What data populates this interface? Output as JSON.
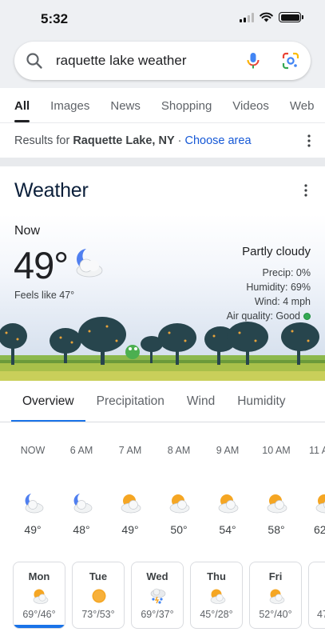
{
  "status_bar": {
    "time": "5:32"
  },
  "search": {
    "query": "raquette lake weather"
  },
  "tabs": [
    "All",
    "Images",
    "News",
    "Shopping",
    "Videos",
    "Web"
  ],
  "results_for": {
    "prefix": "Results for",
    "place": "Raquette Lake, NY",
    "separator": "·",
    "link": "Choose area"
  },
  "weather": {
    "title": "Weather",
    "now_label": "Now",
    "temp": "49°",
    "feels_like": "Feels like 47°",
    "condition": "Partly cloudy",
    "precip": "Precip: 0%",
    "humidity": "Humidity: 69%",
    "wind": "Wind: 4 mph",
    "air_quality": "Air quality: Good"
  },
  "weather_tabs": [
    "Overview",
    "Precipitation",
    "Wind",
    "Humidity"
  ],
  "hourly": [
    {
      "time": "NOW",
      "temp": "49°",
      "icon": "moon-cloud-icon"
    },
    {
      "time": "6 AM",
      "temp": "48°",
      "icon": "moon-cloud-icon"
    },
    {
      "time": "7 AM",
      "temp": "49°",
      "icon": "sun-cloud-icon"
    },
    {
      "time": "8 AM",
      "temp": "50°",
      "icon": "sun-cloud-icon"
    },
    {
      "time": "9 AM",
      "temp": "54°",
      "icon": "sun-cloud-icon"
    },
    {
      "time": "10 AM",
      "temp": "58°",
      "icon": "sun-cloud-icon"
    },
    {
      "time": "11 A",
      "temp": "62",
      "icon": "sun-cloud-icon"
    }
  ],
  "daily": [
    {
      "day": "Mon",
      "range": "69°/46°",
      "icon": "sun-cloud-icon"
    },
    {
      "day": "Tue",
      "range": "73°/53°",
      "icon": "sun-icon"
    },
    {
      "day": "Wed",
      "range": "69°/37°",
      "icon": "rain-thunder-icon"
    },
    {
      "day": "Thu",
      "range": "45°/28°",
      "icon": "sun-cloud-icon"
    },
    {
      "day": "Fri",
      "range": "52°/40°",
      "icon": "sun-cloud-icon"
    },
    {
      "day": "",
      "range": "47",
      "icon": ""
    }
  ],
  "colors": {
    "accent": "#1a73e8",
    "link": "#1558d6",
    "air_good": "#34a853"
  }
}
